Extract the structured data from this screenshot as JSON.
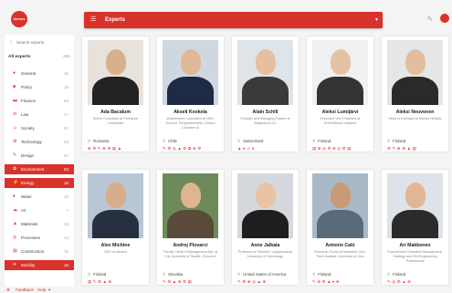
{
  "app": {
    "logo_text": "demos"
  },
  "header": {
    "menu_icon": "menu-icon",
    "title": "Experts",
    "dropdown_icon": "chevron-down-icon"
  },
  "toolbar": {
    "tool_icon": "pencil-icon"
  },
  "colors": {
    "accent": "#d9322a",
    "background": "#f4f4f4",
    "card": "#ffffff"
  },
  "sidebar": {
    "search_placeholder": "Search experts",
    "all_label": "All experts",
    "all_count": "251",
    "categories": [
      {
        "icon": "●",
        "label": "General",
        "count": "16"
      },
      {
        "icon": "■",
        "label": "Policy",
        "count": "19"
      },
      {
        "icon": "▬",
        "label": "Finance",
        "count": "69"
      },
      {
        "icon": "⚖",
        "label": "Law",
        "count": "17"
      },
      {
        "icon": "☺",
        "label": "Society",
        "count": "57"
      },
      {
        "icon": "⚙",
        "label": "Technology",
        "count": "59"
      },
      {
        "icon": "✎",
        "label": "Design",
        "count": "47"
      },
      {
        "icon": "✿",
        "label": "Environment",
        "count": "53"
      },
      {
        "icon": "⚡",
        "label": "Energy",
        "count": "15"
      },
      {
        "icon": "♦",
        "label": "Water",
        "count": "18"
      },
      {
        "icon": "☁",
        "label": "Air",
        "count": "7"
      },
      {
        "icon": "▲",
        "label": "Materials",
        "count": "15"
      },
      {
        "icon": "◎",
        "label": "Processes",
        "count": "14"
      },
      {
        "icon": "▤",
        "label": "Construction",
        "count": "11"
      },
      {
        "icon": "✈",
        "label": "Mobility",
        "count": "16"
      }
    ]
  },
  "footer": {
    "settings_icon": "⚙",
    "feedback": "Feedback",
    "help": "Help",
    "help_icon": "▾"
  },
  "experts": [
    {
      "name": "Ada Bacalum",
      "desc": "Senior Consultant at Freelance Consultant",
      "location": "Romania",
      "tags": "⊕⚙✎⊕⚙▤▲"
    },
    {
      "name": "Akseli Koskela",
      "desc": "Independent Consultant at CMS. Greenci. Perspektivinaha, Chilean Chamber of",
      "location": "Chile",
      "tags": "✎⚙◎▲⚙✿⊕⚙"
    },
    {
      "name": "Alain Schlli",
      "desc": "Founder and Managing Partner at Magnetica LLC",
      "location": "Switzerland",
      "tags": "▲♦☺♦"
    },
    {
      "name": "Aleksi Lumijärvi",
      "desc": "Executive Vice President at GreenStream Network",
      "location": "Finland",
      "tags": "▤⊕◎⚙⊕◎⚙▤"
    },
    {
      "name": "Aleksi Neuvonen",
      "desc": "Head of Foresight at Demos Helsinki",
      "location": "Finland",
      "tags": "⚙✎⊕⚙▲▤"
    },
    {
      "name": "Alex Michine",
      "desc": "CEO at Mentori",
      "location": "Finland",
      "tags": "▤✎⚙▲⊕"
    },
    {
      "name": "Andrej Piovarci",
      "desc": "Faculty, Head of Management Dpt. at City University of Seattle, School of",
      "location": "Slovakia",
      "tags": "✎⚙▲⊕⚙▤"
    },
    {
      "name": "Anne Jalkala",
      "desc": "Professor at Stanford / Lappeenranta University of Technology",
      "location": "United States of America",
      "tags": "✎⚙⊕◎▲⊕"
    },
    {
      "name": "Antonio Calò",
      "desc": "Research Doctor at Nanotech Oulu, Think Institute, University of Oulu",
      "location": "Finland",
      "tags": "✎⊕⚙▲♦⊕"
    },
    {
      "name": "Ari Makkonen",
      "desc": "Experienced Cleantech Management, Strategy and Civil Engineering Professional",
      "location": "Finland",
      "tags": "✎◎⚙▲⊕"
    }
  ]
}
